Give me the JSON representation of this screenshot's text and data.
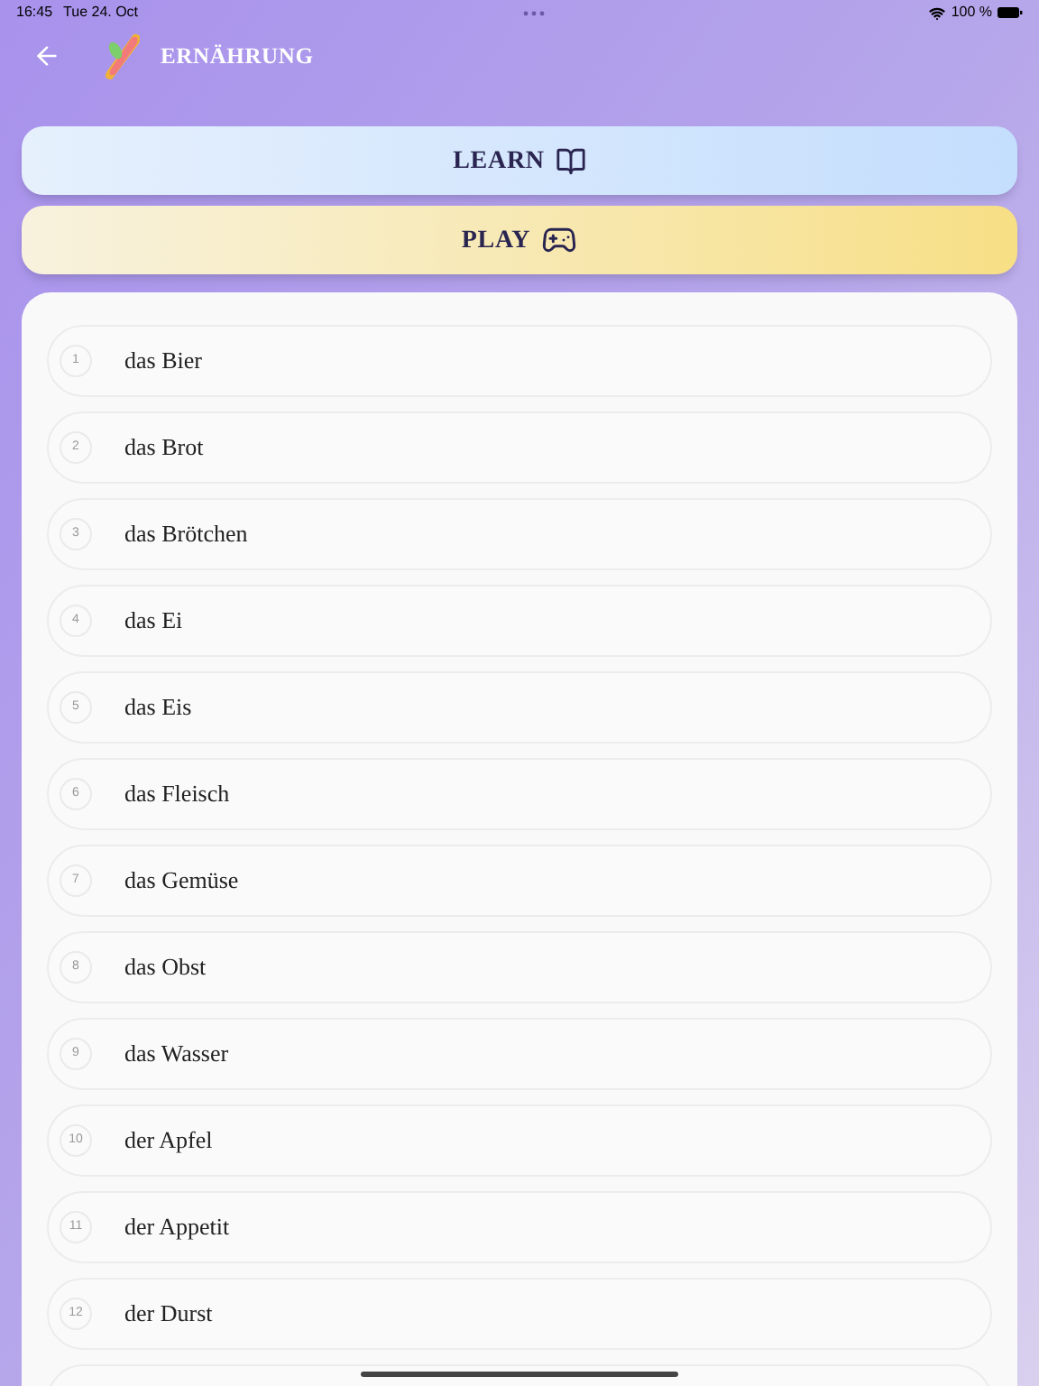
{
  "status_bar": {
    "time": "16:45",
    "date": "Tue 24. Oct",
    "battery": "100 %"
  },
  "header": {
    "title": "ERNÄHRUNG"
  },
  "actions": [
    {
      "label": "LEARN",
      "kind": "learn"
    },
    {
      "label": "PLAY",
      "kind": "play"
    }
  ],
  "words": [
    {
      "number": "1",
      "text": "das Bier"
    },
    {
      "number": "2",
      "text": "das Brot"
    },
    {
      "number": "3",
      "text": "das Brötchen"
    },
    {
      "number": "4",
      "text": "das Ei"
    },
    {
      "number": "5",
      "text": "das Eis"
    },
    {
      "number": "6",
      "text": "das Fleisch"
    },
    {
      "number": "7",
      "text": "das Gemüse"
    },
    {
      "number": "8",
      "text": "das Obst"
    },
    {
      "number": "9",
      "text": "das Wasser"
    },
    {
      "number": "10",
      "text": "der Apfel"
    },
    {
      "number": "11",
      "text": "der Appetit"
    },
    {
      "number": "12",
      "text": "der Durst"
    }
  ]
}
